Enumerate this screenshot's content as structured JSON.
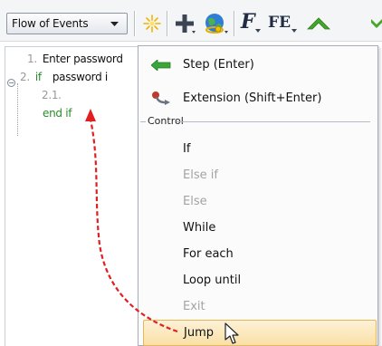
{
  "toolbar": {
    "dropdown_value": "Flow of Events",
    "icons": [
      "new-item-icon",
      "add-icon",
      "globe-icon",
      "f-format-icon",
      "fe-format-icon",
      "move-up-icon"
    ],
    "f_label": "F",
    "fe_label": "FE"
  },
  "editor": {
    "lines": [
      {
        "num": "1.",
        "keyword": "",
        "text": "Enter password"
      },
      {
        "num": "2.",
        "keyword": "if",
        "text": "password i"
      },
      {
        "num": "2.1.",
        "keyword": "",
        "text": ""
      },
      {
        "num": "",
        "keyword": "end if",
        "text": ""
      }
    ]
  },
  "menu": {
    "step_label": "Step (Enter)",
    "extension_label": "Extension (Shift+Enter)",
    "control_group_label": "Control",
    "items": [
      {
        "label": "If",
        "enabled": true
      },
      {
        "label": "Else if",
        "enabled": false
      },
      {
        "label": "Else",
        "enabled": false
      },
      {
        "label": "While",
        "enabled": true
      },
      {
        "label": "For each",
        "enabled": true
      },
      {
        "label": "Loop until",
        "enabled": true
      },
      {
        "label": "Exit",
        "enabled": false
      },
      {
        "label": "Jump",
        "enabled": true,
        "highlighted": true
      }
    ]
  },
  "colors": {
    "keyword": "#2a8a2a",
    "highlight_bg": "#f9e0a6",
    "highlight_border": "#e6b755",
    "arrow": "#e02020"
  }
}
